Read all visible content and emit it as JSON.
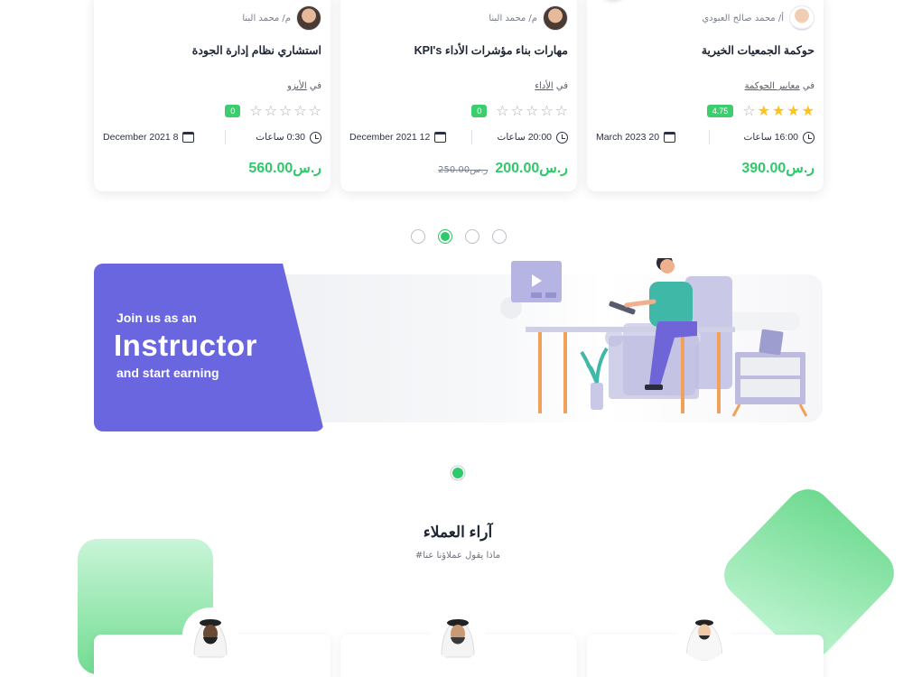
{
  "courses": [
    {
      "instructor": "أ/ محمد صالح العبودي",
      "title": "حوكمة الجمعيات الخيرية",
      "category_prefix": "في",
      "category": "معايير الحوكمة",
      "rating_badge": "4.75",
      "stars_filled": 4,
      "duration": "16:00 ساعات",
      "date": "March 2023 20",
      "price": "ر.س390.00",
      "old_price": ""
    },
    {
      "instructor": "م/ محمد البنا",
      "title": "مهارات بناء مؤشرات الأداء KPI's",
      "category_prefix": "في",
      "category": "الأداء",
      "rating_badge": "0",
      "stars_filled": 0,
      "duration": "20:00 ساعات",
      "date": "December 2021 12",
      "price": "ر.س200.00",
      "old_price": "ر.س250.00"
    },
    {
      "instructor": "م/ محمد البنا",
      "title": "استشاري نظام إدارة الجودة",
      "category_prefix": "في",
      "category": "الأيزو",
      "rating_badge": "0",
      "stars_filled": 0,
      "duration": "0:30 ساعات",
      "date": "December 2021 8",
      "price": "ر.س560.00",
      "old_price": ""
    }
  ],
  "carousel": {
    "dots": 4,
    "active_index": 1
  },
  "banner": {
    "line1": "Join us as an",
    "line2": "Instructor",
    "line3": "and start earning",
    "color": "#6a66e0"
  },
  "testimonials": {
    "title": "آراء العملاء",
    "subtitle": "#ماذا يقول عملاؤنا عنا"
  },
  "colors": {
    "accent": "#2ec96b",
    "star": "#ffc21a"
  }
}
